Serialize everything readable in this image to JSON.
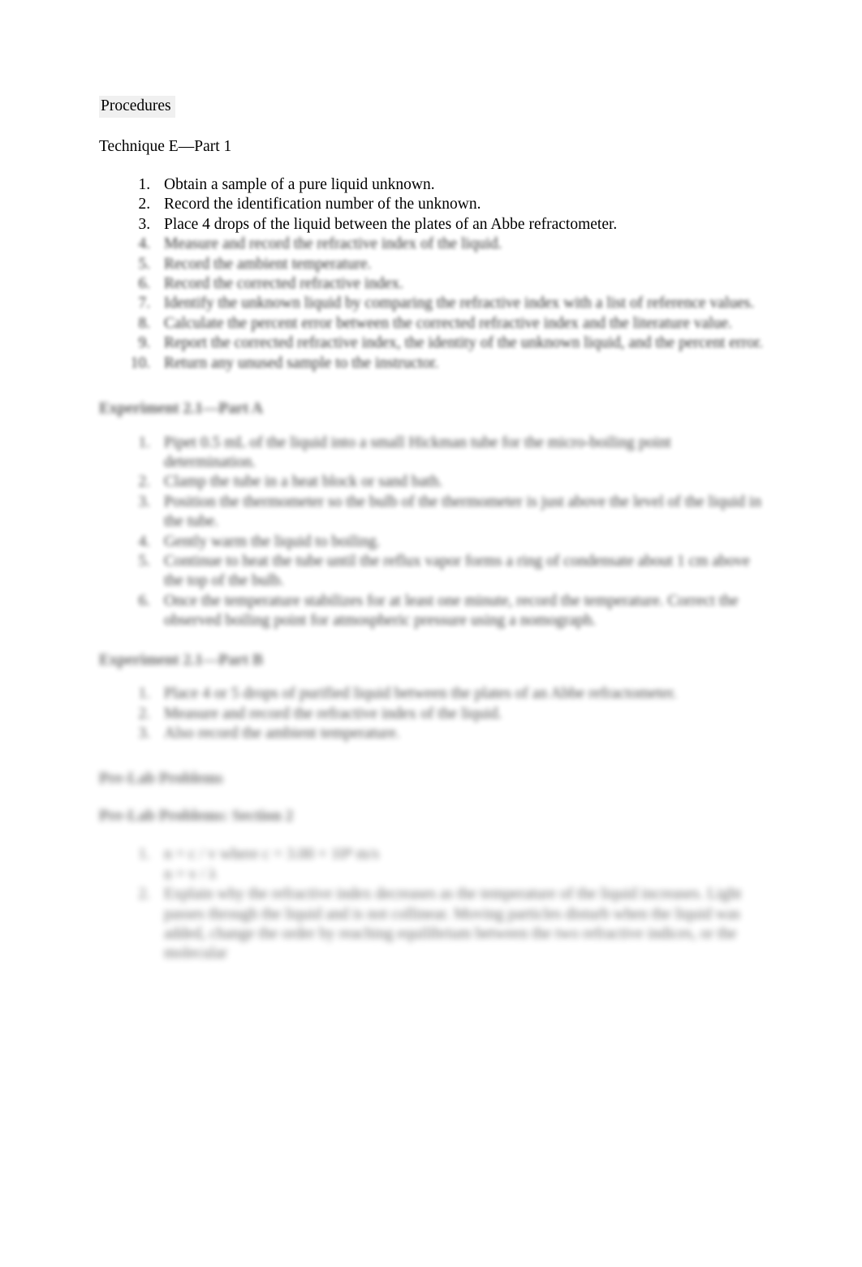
{
  "document": {
    "background_color": "#ffffff",
    "text_color": "#000000",
    "heading_color": "#2b2b2b",
    "procedures_highlight_color": "#f0f0f0"
  },
  "sections": {
    "procedures_heading": "Procedures",
    "technique_heading": "Technique E—Part 1",
    "technique_list": [
      "Obtain a sample of a pure liquid unknown.",
      "Record the identification number of the unknown.",
      "Place 4 drops of the liquid between the plates of an Abbe refractometer."
    ],
    "technique_list_obscured": [
      "Measure and record the refractive index of the liquid.",
      "Record the ambient temperature.",
      "Record the corrected refractive index.",
      "Identify the unknown liquid by comparing the refractive index with a list of reference values.",
      "Calculate the percent error between the corrected refractive index and the literature value.",
      "Report the corrected refractive index, the identity of the unknown liquid, and the percent error.",
      "Return any unused sample to the instructor."
    ],
    "experiment_a_heading": "Experiment 2.1—Part A",
    "experiment_a_list_obscured": [
      "Pipet 0.5 mL of the liquid into a small Hickman tube for the micro-boiling point determination.",
      "Clamp the tube in a heat block or sand bath.",
      "Position the thermometer so the bulb of the thermometer is just above the level of the liquid in the tube.",
      "Gently warm the liquid to boiling.",
      "Continue to heat the tube until the reflux vapor forms a ring of condensate about 1 cm above the top of the bulb.",
      "Once the temperature stabilizes for at least one minute, record the temperature. Correct the observed boiling point for atmospheric pressure using a nomograph."
    ],
    "experiment_b_heading": "Experiment 2.1—Part B",
    "experiment_b_list_obscured": [
      "Place 4 or 5 drops of purified liquid between the plates of an Abbe refractometer.",
      "Measure and record the refractive index of the liquid.",
      "Also record the ambient temperature."
    ],
    "prelab_heading": "Pre-Lab Problems",
    "prelab_section_heading": "Pre-Lab Problems: Section 2",
    "prelab_list_obscured": [
      "n = c / v  where c = 3.00 × 10⁸ m/s",
      "Explain why the refractive index decreases as the temperature of the liquid increases. Light passes through the liquid and is not collinear. Moving particles disturb when the liquid was added, change the order by reaching equilibrium between the two refractive indices, or the molecular"
    ],
    "prelab_sub_line_obscured": "n = v / λ"
  }
}
